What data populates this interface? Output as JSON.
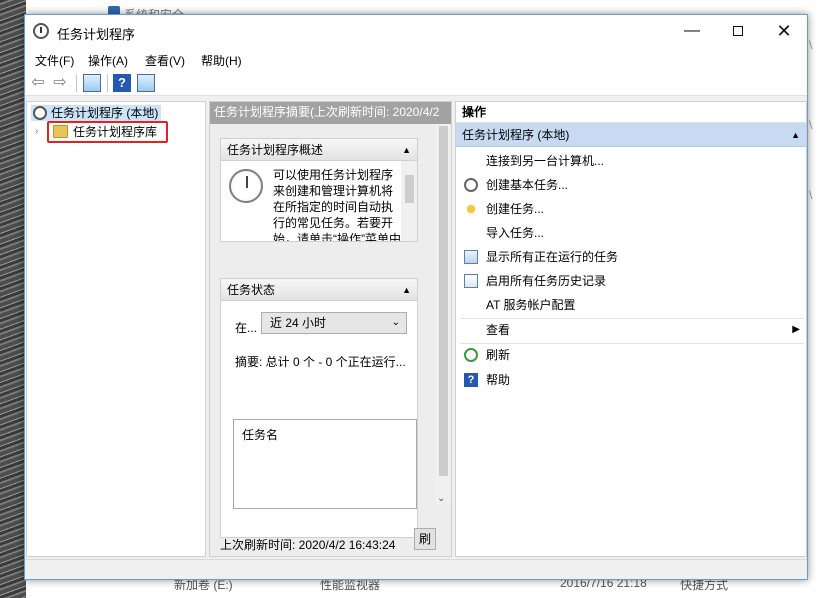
{
  "background": {
    "top_text": "系统和安全",
    "bottom_drive": "新加卷 (E:)",
    "bottom_file": "性能监视器",
    "bottom_date": "2016/7/16 21:18",
    "bottom_type": "快捷方式",
    "side_marks": [
      "\\",
      "\\",
      "\\"
    ]
  },
  "window": {
    "title": "任务计划程序",
    "controls": {
      "minimize": "—",
      "close": "✕"
    }
  },
  "menu": [
    "文件(F)",
    "操作(A)",
    "查看(V)",
    "帮助(H)"
  ],
  "toolbar": {
    "back": "⇦",
    "forward": "⇨",
    "help": "?"
  },
  "tree": {
    "root": "任务计划程序 (本地)",
    "expand_arrow": "›",
    "child": "任务计划程序库"
  },
  "middle": {
    "header": "任务计划程序摘要(上次刷新时间: 2020/4/2",
    "overview": {
      "title": "任务计划程序概述",
      "text": "可以使用任务计划程序来创建和管理计算机将在所指定的时间自动执行的常见任务。若要开始，请单击“操作”菜单中的"
    },
    "status": {
      "title": "任务状态",
      "in_label": "在...",
      "period": "近 24 小时",
      "summary": "摘要: 总计 0 个 - 0 个正在运行...",
      "task_name_header": "任务名"
    },
    "footer": "上次刷新时间: 2020/4/2 16:43:24",
    "refresh": "刷"
  },
  "actions": {
    "title": "操作",
    "group": "任务计划程序 (本地)",
    "items": [
      {
        "label": "连接到另一台计算机..."
      },
      {
        "label": "创建基本任务..."
      },
      {
        "label": "创建任务..."
      },
      {
        "label": "导入任务..."
      },
      {
        "label": "显示所有正在运行的任务"
      },
      {
        "label": "启用所有任务历史记录"
      },
      {
        "label": "AT 服务帐户配置"
      },
      {
        "label": "查看",
        "submenu_arrow": "▶"
      },
      {
        "label": "刷新"
      },
      {
        "label": "帮助"
      }
    ]
  },
  "icons": {
    "collapse_caret": "▲",
    "scroll_down": "⌄",
    "select_chevron": "⌄"
  },
  "colors": {
    "accent_blue": "#2458b3",
    "highlight_red": "#e4231c",
    "group_bg": "#c7daf2",
    "selection_bg": "#cce4f7"
  }
}
